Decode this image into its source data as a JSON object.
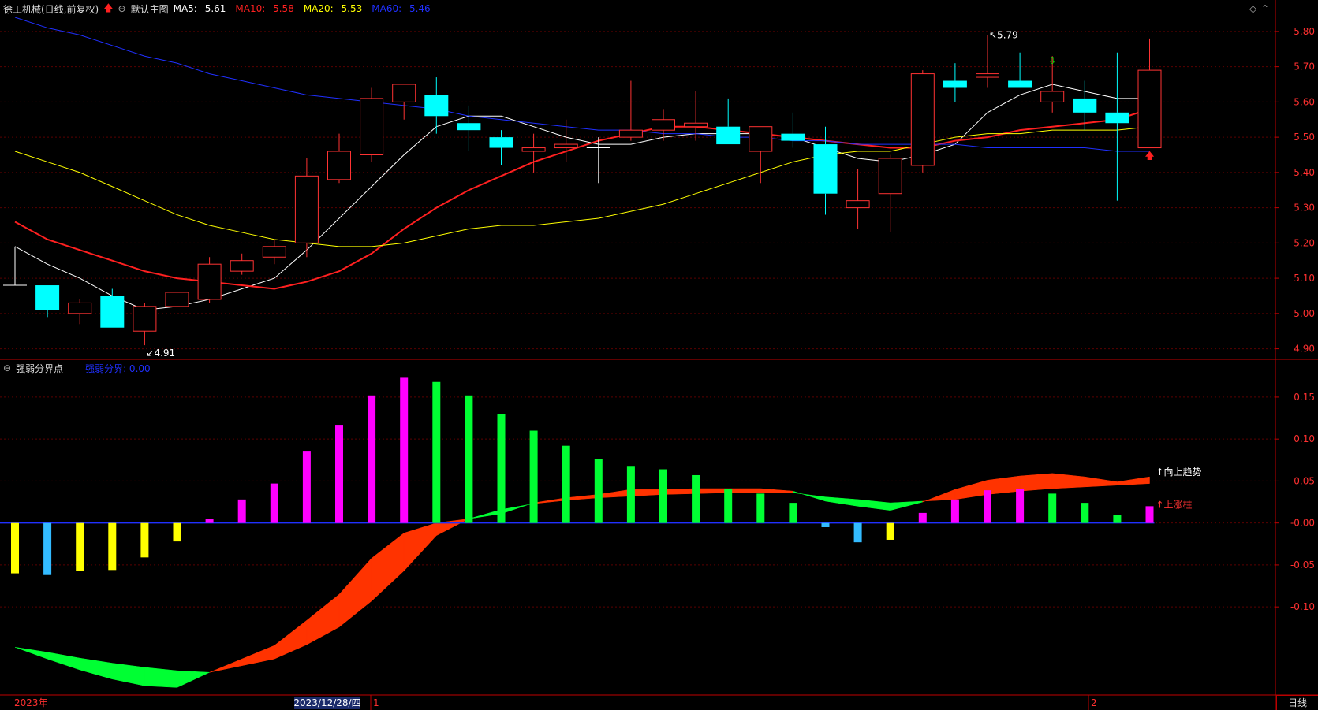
{
  "header": {
    "stock_name": "徐工机械(日线,前复权)",
    "main_indicator": "默认主图",
    "ma5": {
      "label": "MA5:",
      "value": "5.61",
      "color": "#ffffff"
    },
    "ma10": {
      "label": "MA10:",
      "value": "5.58",
      "color": "#ff2020"
    },
    "ma20": {
      "label": "MA20:",
      "value": "5.53",
      "color": "#ffff00"
    },
    "ma60": {
      "label": "MA60:",
      "value": "5.46",
      "color": "#2030ff"
    }
  },
  "sub_header": {
    "indicator": "强弱分界点",
    "value_label": "强弱分界: 0.00"
  },
  "timeframe": "日线",
  "chart_data": [
    {
      "type": "candlestick",
      "y_axis": {
        "range": [
          4.87,
          5.84
        ],
        "ticks": [
          "5.80",
          "5.70",
          "5.60",
          "5.50",
          "5.40",
          "5.30",
          "5.20",
          "5.10",
          "5.00",
          "4.90"
        ]
      },
      "x_labels": [
        "2023年",
        "2023/12/28/四",
        "1",
        "2"
      ],
      "annotations": [
        {
          "text": "5.79",
          "type": "high"
        },
        {
          "text": "4.91",
          "type": "low"
        }
      ],
      "candles": [
        {
          "o": 5.08,
          "h": 5.19,
          "l": 5.08,
          "c": 5.08
        },
        {
          "o": 5.08,
          "h": 5.08,
          "l": 4.99,
          "c": 5.01
        },
        {
          "o": 5.0,
          "h": 5.04,
          "l": 4.97,
          "c": 5.03
        },
        {
          "o": 5.05,
          "h": 5.07,
          "l": 4.96,
          "c": 4.96
        },
        {
          "o": 4.95,
          "h": 5.03,
          "l": 4.91,
          "c": 5.02
        },
        {
          "o": 5.02,
          "h": 5.13,
          "l": 5.02,
          "c": 5.06
        },
        {
          "o": 5.04,
          "h": 5.16,
          "l": 5.03,
          "c": 5.14
        },
        {
          "o": 5.12,
          "h": 5.17,
          "l": 5.11,
          "c": 5.15
        },
        {
          "o": 5.16,
          "h": 5.21,
          "l": 5.14,
          "c": 5.19
        },
        {
          "o": 5.2,
          "h": 5.44,
          "l": 5.16,
          "c": 5.39
        },
        {
          "o": 5.38,
          "h": 5.51,
          "l": 5.37,
          "c": 5.46
        },
        {
          "o": 5.45,
          "h": 5.64,
          "l": 5.43,
          "c": 5.61
        },
        {
          "o": 5.6,
          "h": 5.65,
          "l": 5.55,
          "c": 5.65
        },
        {
          "o": 5.62,
          "h": 5.67,
          "l": 5.51,
          "c": 5.56
        },
        {
          "o": 5.54,
          "h": 5.59,
          "l": 5.46,
          "c": 5.52
        },
        {
          "o": 5.5,
          "h": 5.52,
          "l": 5.42,
          "c": 5.47
        },
        {
          "o": 5.46,
          "h": 5.51,
          "l": 5.4,
          "c": 5.47
        },
        {
          "o": 5.47,
          "h": 5.55,
          "l": 5.43,
          "c": 5.48
        },
        {
          "o": 5.47,
          "h": 5.5,
          "l": 5.37,
          "c": 5.47
        },
        {
          "o": 5.5,
          "h": 5.66,
          "l": 5.49,
          "c": 5.52
        },
        {
          "o": 5.52,
          "h": 5.58,
          "l": 5.49,
          "c": 5.55
        },
        {
          "o": 5.53,
          "h": 5.63,
          "l": 5.49,
          "c": 5.54
        },
        {
          "o": 5.53,
          "h": 5.61,
          "l": 5.48,
          "c": 5.48
        },
        {
          "o": 5.46,
          "h": 5.53,
          "l": 5.37,
          "c": 5.53
        },
        {
          "o": 5.51,
          "h": 5.57,
          "l": 5.47,
          "c": 5.49
        },
        {
          "o": 5.48,
          "h": 5.53,
          "l": 5.28,
          "c": 5.34
        },
        {
          "o": 5.3,
          "h": 5.41,
          "l": 5.24,
          "c": 5.32
        },
        {
          "o": 5.34,
          "h": 5.45,
          "l": 5.23,
          "c": 5.44
        },
        {
          "o": 5.42,
          "h": 5.69,
          "l": 5.4,
          "c": 5.68
        },
        {
          "o": 5.66,
          "h": 5.71,
          "l": 5.6,
          "c": 5.64
        },
        {
          "o": 5.67,
          "h": 5.79,
          "l": 5.64,
          "c": 5.68
        },
        {
          "o": 5.66,
          "h": 5.74,
          "l": 5.64,
          "c": 5.64
        },
        {
          "o": 5.6,
          "h": 5.73,
          "l": 5.57,
          "c": 5.63
        },
        {
          "o": 5.61,
          "h": 5.66,
          "l": 5.52,
          "c": 5.57
        },
        {
          "o": 5.57,
          "h": 5.74,
          "l": 5.32,
          "c": 5.54
        },
        {
          "o": 5.47,
          "h": 5.78,
          "l": 5.47,
          "c": 5.69
        }
      ],
      "series": [
        {
          "name": "MA5",
          "color": "#ffffff",
          "values": [
            5.19,
            5.14,
            5.1,
            5.05,
            5.01,
            5.02,
            5.04,
            5.07,
            5.1,
            5.18,
            5.27,
            5.36,
            5.45,
            5.53,
            5.56,
            5.56,
            5.53,
            5.5,
            5.48,
            5.48,
            5.5,
            5.51,
            5.51,
            5.51,
            5.5,
            5.47,
            5.44,
            5.43,
            5.45,
            5.48,
            5.57,
            5.62,
            5.65,
            5.63,
            5.61,
            5.61
          ]
        },
        {
          "name": "MA10",
          "color": "#ff2020",
          "values": [
            5.26,
            5.21,
            5.18,
            5.15,
            5.12,
            5.1,
            5.09,
            5.08,
            5.07,
            5.09,
            5.12,
            5.17,
            5.24,
            5.3,
            5.35,
            5.39,
            5.43,
            5.46,
            5.49,
            5.51,
            5.53,
            5.53,
            5.52,
            5.51,
            5.5,
            5.49,
            5.48,
            5.47,
            5.47,
            5.49,
            5.5,
            5.52,
            5.53,
            5.54,
            5.55,
            5.58
          ]
        },
        {
          "name": "MA20",
          "color": "#ffff00",
          "values": [
            5.46,
            5.43,
            5.4,
            5.36,
            5.32,
            5.28,
            5.25,
            5.23,
            5.21,
            5.2,
            5.19,
            5.19,
            5.2,
            5.22,
            5.24,
            5.25,
            5.25,
            5.26,
            5.27,
            5.29,
            5.31,
            5.34,
            5.37,
            5.4,
            5.43,
            5.45,
            5.46,
            5.46,
            5.48,
            5.5,
            5.51,
            5.51,
            5.52,
            5.52,
            5.52,
            5.53
          ]
        },
        {
          "name": "MA60",
          "color": "#2030ff",
          "values": [
            5.84,
            5.81,
            5.79,
            5.76,
            5.73,
            5.71,
            5.68,
            5.66,
            5.64,
            5.62,
            5.61,
            5.6,
            5.59,
            5.58,
            5.56,
            5.55,
            5.54,
            5.53,
            5.52,
            5.52,
            5.51,
            5.51,
            5.5,
            5.5,
            5.49,
            5.49,
            5.48,
            5.48,
            5.48,
            5.48,
            5.47,
            5.47,
            5.47,
            5.47,
            5.46,
            5.46
          ]
        }
      ],
      "signals": [
        {
          "index": 32,
          "type": "down-arrow",
          "color": "#00ff00"
        },
        {
          "index": 35,
          "type": "up-arrow",
          "color": "#ff2020"
        }
      ]
    },
    {
      "type": "bar",
      "title": "强弱分界点",
      "y_axis": {
        "range": [
          -0.205,
          0.195
        ],
        "ticks": [
          "0.15",
          "0.10",
          "0.05",
          "-0.00",
          "-0.05",
          "-0.10"
        ]
      },
      "bars": [
        {
          "v": -0.06,
          "color": "#ffff00"
        },
        {
          "v": -0.062,
          "color": "#33bbff"
        },
        {
          "v": -0.057,
          "color": "#ffff00"
        },
        {
          "v": -0.056,
          "color": "#ffff00"
        },
        {
          "v": -0.041,
          "color": "#ffff00"
        },
        {
          "v": -0.022,
          "color": "#ffff00"
        },
        {
          "v": 0.005,
          "color": "#ff00ff"
        },
        {
          "v": 0.028,
          "color": "#ff00ff"
        },
        {
          "v": 0.047,
          "color": "#ff00ff"
        },
        {
          "v": 0.086,
          "color": "#ff00ff"
        },
        {
          "v": 0.117,
          "color": "#ff00ff"
        },
        {
          "v": 0.152,
          "color": "#ff00ff"
        },
        {
          "v": 0.173,
          "color": "#ff00ff"
        },
        {
          "v": 0.168,
          "color": "#00ff33"
        },
        {
          "v": 0.152,
          "color": "#00ff33"
        },
        {
          "v": 0.13,
          "color": "#00ff33"
        },
        {
          "v": 0.11,
          "color": "#00ff33"
        },
        {
          "v": 0.092,
          "color": "#00ff33"
        },
        {
          "v": 0.076,
          "color": "#00ff33"
        },
        {
          "v": 0.068,
          "color": "#00ff33"
        },
        {
          "v": 0.064,
          "color": "#00ff33"
        },
        {
          "v": 0.057,
          "color": "#00ff33"
        },
        {
          "v": 0.041,
          "color": "#00ff33"
        },
        {
          "v": 0.035,
          "color": "#00ff33"
        },
        {
          "v": 0.024,
          "color": "#00ff33"
        },
        {
          "v": -0.005,
          "color": "#33bbff"
        },
        {
          "v": -0.023,
          "color": "#33bbff"
        },
        {
          "v": -0.02,
          "color": "#ffff00"
        },
        {
          "v": 0.012,
          "color": "#ff00ff"
        },
        {
          "v": 0.028,
          "color": "#ff00ff"
        },
        {
          "v": 0.039,
          "color": "#ff00ff"
        },
        {
          "v": 0.041,
          "color": "#ff00ff"
        },
        {
          "v": 0.035,
          "color": "#00ff33"
        },
        {
          "v": 0.024,
          "color": "#00ff33"
        },
        {
          "v": 0.01,
          "color": "#00ff33"
        },
        {
          "v": 0.02,
          "color": "#ff00ff"
        }
      ],
      "band": {
        "lower": [
          -0.148,
          -0.154,
          -0.161,
          -0.167,
          -0.172,
          -0.176,
          -0.178,
          -0.17,
          -0.162,
          -0.145,
          -0.124,
          -0.093,
          -0.057,
          -0.015,
          0.005,
          0.016,
          0.023,
          0.027,
          0.03,
          0.032,
          0.034,
          0.035,
          0.036,
          0.036,
          0.036,
          0.031,
          0.028,
          0.024,
          0.026,
          0.028,
          0.034,
          0.038,
          0.041,
          0.043,
          0.045,
          0.047
        ],
        "upper": [
          -0.148,
          -0.162,
          -0.175,
          -0.186,
          -0.194,
          -0.196,
          -0.178,
          -0.162,
          -0.146,
          -0.116,
          -0.085,
          -0.042,
          -0.012,
          0.0,
          0.005,
          0.011,
          0.024,
          0.03,
          0.034,
          0.04,
          0.04,
          0.041,
          0.041,
          0.041,
          0.038,
          0.026,
          0.02,
          0.015,
          0.025,
          0.04,
          0.051,
          0.056,
          0.059,
          0.055,
          0.049,
          0.055
        ],
        "up_color": "#ff3300",
        "down_color": "#00ff33"
      },
      "annotations": [
        {
          "text": "↑向上趋势",
          "color": "#ffffff"
        },
        {
          "text": "↑上涨柱",
          "color": "#ff3333"
        }
      ]
    }
  ]
}
